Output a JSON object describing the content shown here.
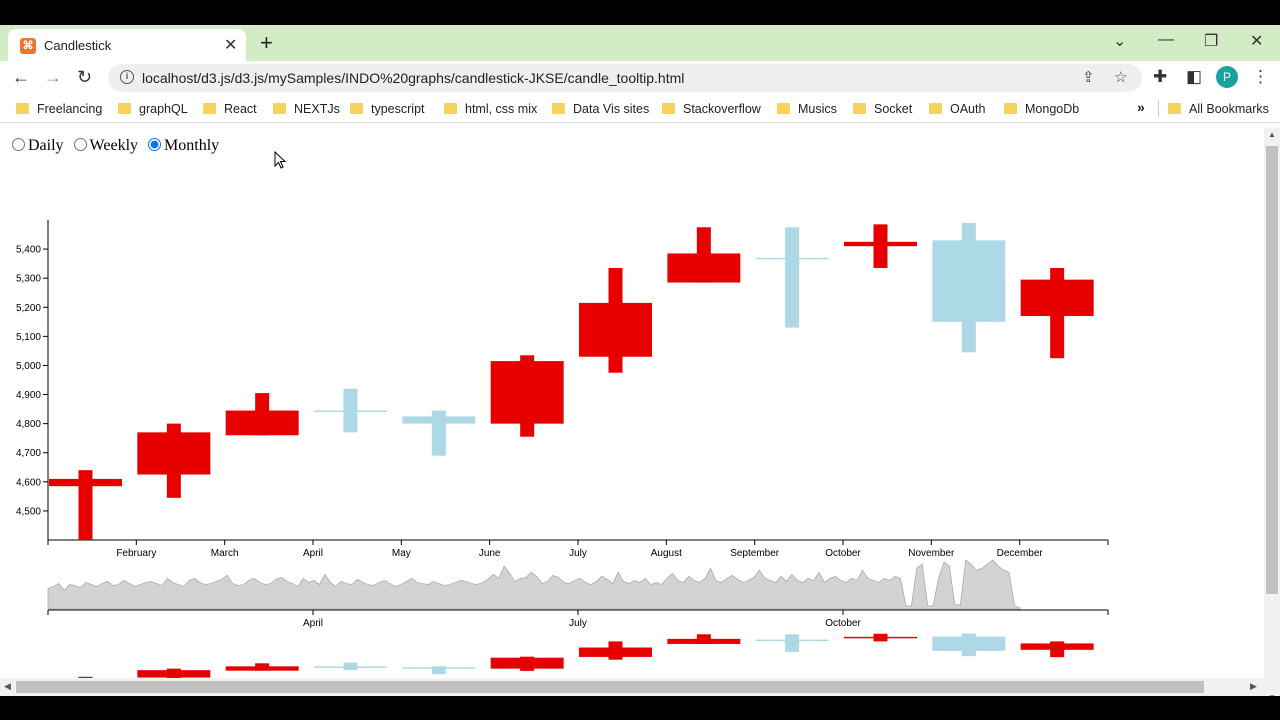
{
  "browser": {
    "tab_title": "Candlestick",
    "url": "localhost/d3.js/d3.js/mySamples/INDO%20graphs/candlestick-JKSE/candle_tooltip.html",
    "avatar_letter": "P",
    "bookmarks": [
      "Freelancing",
      "graphQL",
      "React",
      "NEXTJs",
      "typescript",
      "html, css mix",
      "Data Vis sites",
      "Stackoverflow",
      "Musics",
      "Socket",
      "OAuth",
      "MongoDb"
    ],
    "bookmarks_more": "»",
    "all_bookmarks": "All Bookmarks"
  },
  "controls": {
    "options": [
      "Daily",
      "Weekly",
      "Monthly"
    ],
    "selected": "Monthly"
  },
  "colors": {
    "up": "#e60000",
    "down": "#add8e6",
    "volume_fill": "#d3d3d3",
    "volume_stroke": "#999999"
  },
  "chart_data": {
    "type": "candlestick",
    "title": "",
    "xlabel": "",
    "ylabel": "",
    "ylim": [
      4400,
      5500
    ],
    "yticks": [
      4500,
      4600,
      4700,
      4800,
      4900,
      5000,
      5100,
      5200,
      5300,
      5400
    ],
    "ytick_labels": [
      "4,500",
      "4,600",
      "4,700",
      "4,800",
      "4,900",
      "5,000",
      "5,100",
      "5,200",
      "5,300",
      "5,400"
    ],
    "x_tick_labels": [
      "February",
      "March",
      "April",
      "May",
      "June",
      "July",
      "August",
      "September",
      "October",
      "November",
      "December"
    ],
    "candles": [
      {
        "open": 4585,
        "close": 4610,
        "high": 4640,
        "low": 4400,
        "color": "up"
      },
      {
        "open": 4625,
        "close": 4770,
        "high": 4800,
        "low": 4545,
        "color": "up"
      },
      {
        "open": 4760,
        "close": 4845,
        "high": 4905,
        "low": 4760,
        "color": "up"
      },
      {
        "open": 4845,
        "close": 4840,
        "high": 4920,
        "low": 4770,
        "color": "down"
      },
      {
        "open": 4825,
        "close": 4800,
        "high": 4845,
        "low": 4690,
        "color": "down"
      },
      {
        "open": 4800,
        "close": 5015,
        "high": 5035,
        "low": 4755,
        "color": "up"
      },
      {
        "open": 5030,
        "close": 5215,
        "high": 5335,
        "low": 4975,
        "color": "up"
      },
      {
        "open": 5285,
        "close": 5385,
        "high": 5475,
        "low": 5285,
        "color": "up"
      },
      {
        "open": 5370,
        "close": 5365,
        "high": 5475,
        "low": 5130,
        "color": "down"
      },
      {
        "open": 5410,
        "close": 5425,
        "high": 5485,
        "low": 5335,
        "color": "up"
      },
      {
        "open": 5430,
        "close": 5150,
        "high": 5490,
        "low": 5045,
        "color": "down"
      },
      {
        "open": 5170,
        "close": 5295,
        "high": 5335,
        "low": 5025,
        "color": "up"
      }
    ],
    "brush_x_tick_labels": [
      "April",
      "July",
      "October"
    ],
    "volume_series": [
      20,
      22,
      25,
      18,
      24,
      23,
      21,
      26,
      24,
      22,
      25,
      27,
      23,
      24,
      28,
      25,
      22,
      24,
      26,
      27,
      25,
      23,
      30,
      26,
      24,
      22,
      28,
      30,
      26,
      24,
      25,
      27,
      29,
      33,
      25,
      23,
      24,
      28,
      30,
      26,
      24,
      25,
      29,
      31,
      27,
      25,
      22,
      30,
      26,
      28,
      24,
      34,
      26,
      22,
      27,
      25,
      24,
      29,
      26,
      24,
      23,
      26,
      28,
      25,
      22,
      24,
      27,
      30,
      26,
      25,
      24,
      27,
      25,
      23,
      24,
      26,
      28,
      27,
      25,
      24,
      26,
      29,
      34,
      30,
      42,
      35,
      27,
      30,
      31,
      36,
      32,
      25,
      27,
      33,
      31,
      26,
      25,
      28,
      30,
      26,
      24,
      27,
      32,
      29,
      25,
      36,
      27,
      25,
      28,
      26,
      30,
      24,
      26,
      24,
      30,
      35,
      28,
      26,
      32,
      28,
      26,
      30,
      40,
      28,
      26,
      30,
      33,
      29,
      26,
      28,
      31,
      38,
      30,
      28,
      26,
      32,
      27,
      34,
      28,
      26,
      30,
      28,
      36,
      26,
      30,
      32,
      28,
      26,
      30,
      28,
      38,
      30,
      28,
      26,
      30,
      28,
      32,
      30,
      3,
      3,
      40,
      44,
      3,
      3,
      30,
      46,
      42,
      4,
      4,
      48,
      44,
      38,
      40,
      44,
      48,
      42,
      38,
      36,
      3,
      1
    ]
  }
}
